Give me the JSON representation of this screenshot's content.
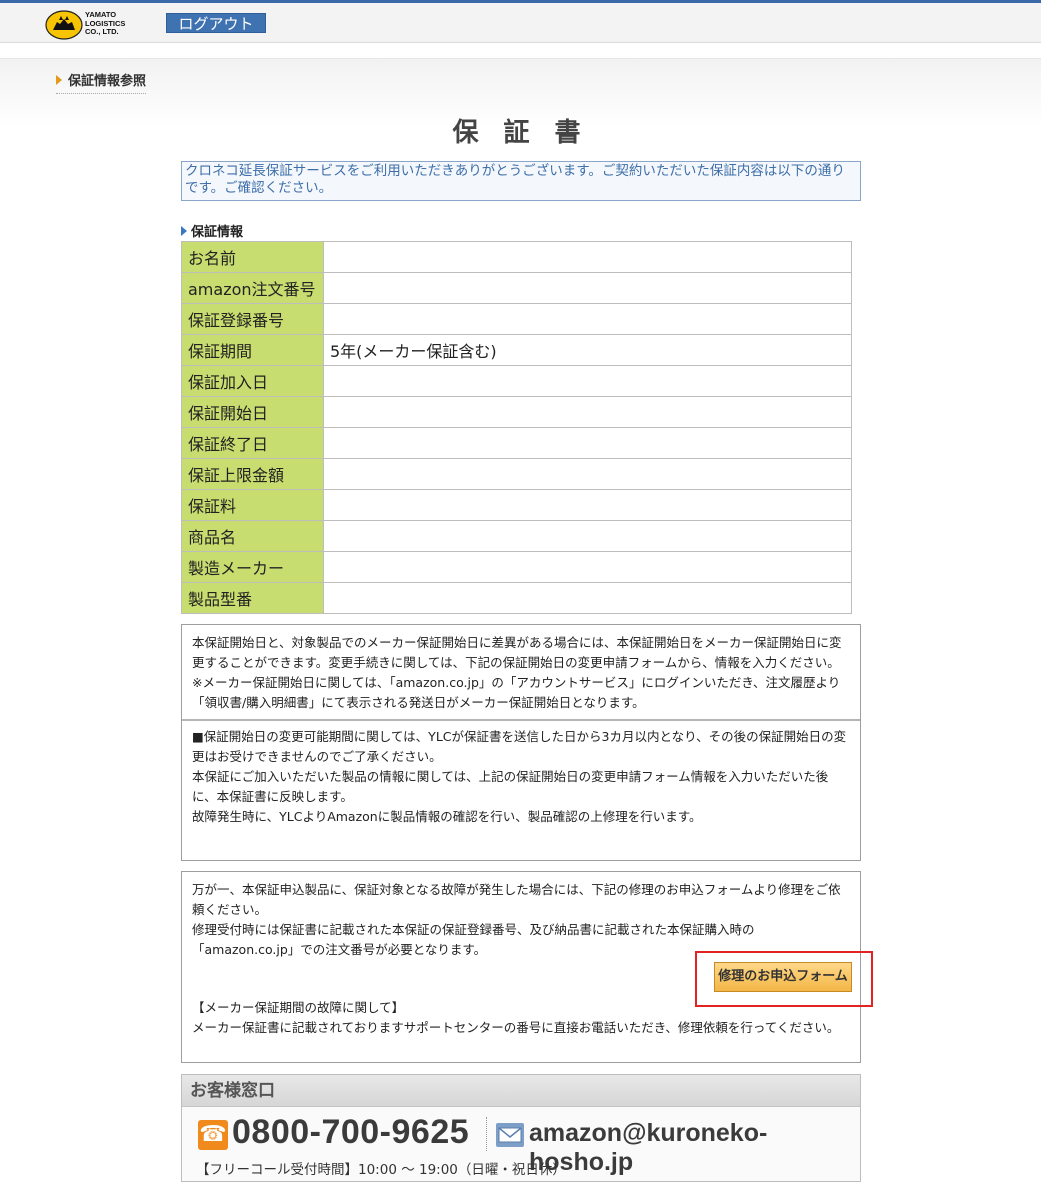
{
  "header": {
    "logo_text": "YAMATO\nLOGISTICS\nCO., LTD.",
    "logout_label": "ログアウト"
  },
  "breadcrumb": {
    "label": "保証情報参照"
  },
  "page_title": "保 証 書",
  "notice": "クロネコ延長保証サービスをご利用いただきありがとうございます。ご契約いただいた保証内容は以下の通りです。ご確認ください。",
  "section_label": "保証情報",
  "info_rows": [
    {
      "label": "お名前",
      "value": ""
    },
    {
      "label": "amazon注文番号",
      "value": ""
    },
    {
      "label": "保証登録番号",
      "value": ""
    },
    {
      "label": "保証期間",
      "value": "5年(メーカー保証含む)"
    },
    {
      "label": "保証加入日",
      "value": ""
    },
    {
      "label": "保証開始日",
      "value": ""
    },
    {
      "label": "保証終了日",
      "value": ""
    },
    {
      "label": "保証上限金額",
      "value": ""
    },
    {
      "label": "保証料",
      "value": ""
    },
    {
      "label": "商品名",
      "value": ""
    },
    {
      "label": "製造メーカー",
      "value": ""
    },
    {
      "label": "製品型番",
      "value": ""
    }
  ],
  "box1": {
    "p1": "本保証開始日と、対象製品でのメーカー保証開始日に差異がある場合には、本保証開始日をメーカー保証開始日に変更することができます。変更手続きに関しては、下記の保証開始日の変更申請フォームから、情報を入力ください。",
    "p2": "※メーカー保証開始日に関しては、「amazon.co.jp」の「アカウントサービス」にログインいただき、注文履歴より「領収書/購入明細書」にて表示される発送日がメーカー保証開始日となります。",
    "p3": "■保証開始日の変更可能期間に関しては、YLCが保証書を送信した日から3カ月以内となり、その後の保証開始日の変更はお受けできませんのでご了承ください。",
    "p4": "本保証にご加入いただいた製品の情報に関しては、上記の保証開始日の変更申請フォーム情報を入力いただいた後に、本保証書に反映します。",
    "p5": "故障発生時に、YLCよりAmazonに製品情報の確認を行い、製品確認の上修理を行います。"
  },
  "box2": {
    "p1": "万が一、本保証申込製品に、保証対象となる故障が発生した場合には、下記の修理のお申込フォームより修理をご依頼ください。",
    "p2": "修理受付時には保証書に記載された本保証の保証登録番号、及び納品書に記載された本保証購入時の「amazon.co.jp」での注文番号が必要となります。",
    "apply_button": "修理のお申込フォーム",
    "p3": "【メーカー保証期間の故障に関して】",
    "p4": "メーカー保証書に記載されておりますサポートセンターの番号に直接お電話いただき、修理依頼を行ってください。"
  },
  "contact": {
    "heading": "お客様窓口",
    "phone": "0800-700-9625",
    "email": "amazon@kuroneko-hosho.jp",
    "hours": "【フリーコール受付時間】10:00 〜 19:00（日曜・祝日休）"
  },
  "colors": {
    "accent_blue": "#3f72b0",
    "label_green": "#c7dd6f",
    "highlight_red": "#e32222",
    "button_orange": "#f3b646"
  }
}
